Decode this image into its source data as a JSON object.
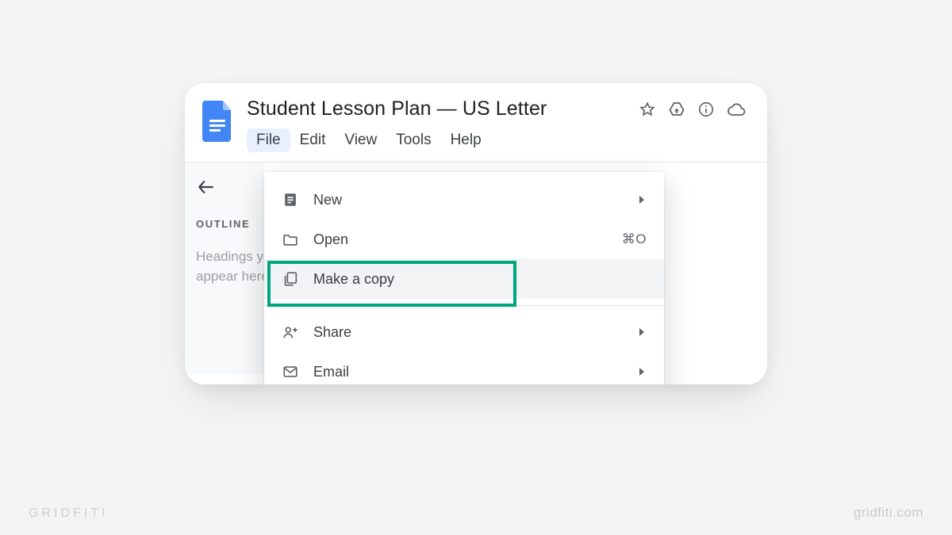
{
  "document": {
    "title": "Student Lesson Plan — US Letter"
  },
  "menubar": {
    "items": [
      "File",
      "Edit",
      "View",
      "Tools",
      "Help"
    ],
    "active_index": 0
  },
  "sidebar": {
    "outline_label": "OUTLINE",
    "hint_line1": "Headings you add to the document will",
    "hint_line2": "appear here."
  },
  "file_menu": {
    "items": [
      {
        "icon": "doc-new-icon",
        "label": "New",
        "submenu": true
      },
      {
        "icon": "folder-icon",
        "label": "Open",
        "shortcut": "⌘O"
      },
      {
        "icon": "copy-icon",
        "label": "Make a copy",
        "highlighted": true
      },
      {
        "separator": true
      },
      {
        "icon": "share-icon",
        "label": "Share",
        "submenu": true
      },
      {
        "icon": "email-icon",
        "label": "Email",
        "submenu": true
      }
    ]
  },
  "footer": {
    "left": "GRIDFITI",
    "right": "gridfiti.com"
  }
}
